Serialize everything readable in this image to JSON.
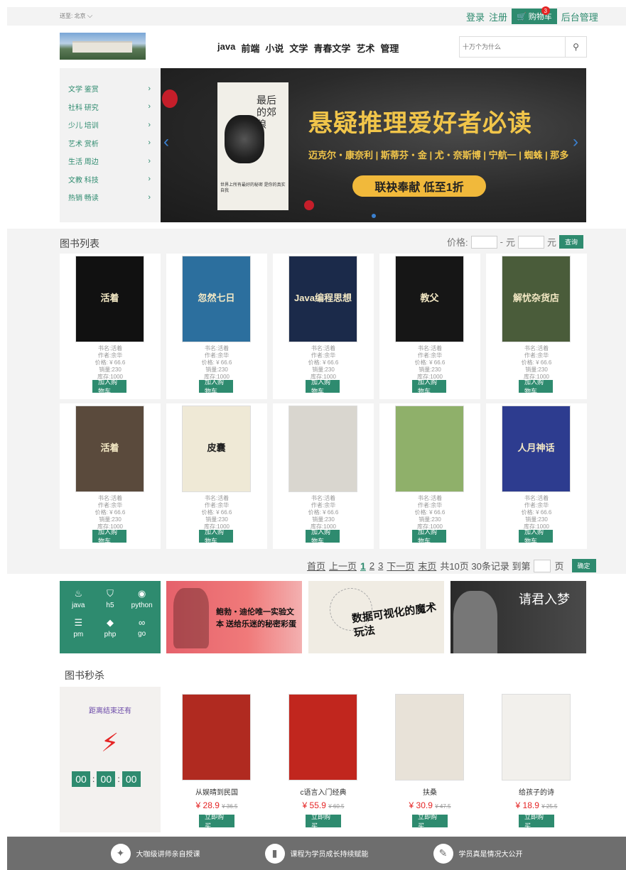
{
  "topbar": {
    "location": "送至: 北京",
    "login": "登录",
    "register": "注册",
    "cart_label": "购物车",
    "cart_count": "3",
    "admin": "后台管理"
  },
  "nav": {
    "items": [
      "java",
      "前端",
      "小说",
      "文学",
      "青春文学",
      "艺术",
      "管理"
    ]
  },
  "search": {
    "placeholder": "十万个为什么"
  },
  "categories": [
    "文学 鉴赏",
    "社科 研究",
    "少儿 培训",
    "艺术 赏析",
    "生活 周边",
    "文教 科技",
    "热销 畅读"
  ],
  "banner": {
    "headline": "悬疑推理爱好者必读",
    "authors": "迈克尔・康奈利 | 斯蒂芬・金 | 尤・奈斯博 | 宁航一 | 蜘蛛 | 那多",
    "promo": "联袂奉献  低至1折",
    "book_title": "最后的郊狼",
    "book_sub": "世界上所有最好的秘密 是你的真实自我"
  },
  "list": {
    "title": "图书列表",
    "price_label": "价格:",
    "unit": "元",
    "dash": "-",
    "query": "查询",
    "books": [
      {
        "name": "书名:活着",
        "author": "作者:余华",
        "price": "价格: ¥ 66.6",
        "sales": "销量:230",
        "stock": "库存:1000",
        "btn": "加入购物车",
        "cover_color": "#111111",
        "cover_text": "活着"
      },
      {
        "name": "书名:活着",
        "author": "作者:余华",
        "price": "价格: ¥ 66.6",
        "sales": "销量:230",
        "stock": "库存:1000",
        "btn": "加入购物车",
        "cover_color": "#2c6f9e",
        "cover_text": "忽然七日"
      },
      {
        "name": "书名:活着",
        "author": "作者:余华",
        "price": "价格: ¥ 66.6",
        "sales": "销量:230",
        "stock": "库存:1000",
        "btn": "加入购物车",
        "cover_color": "#1b2a4a",
        "cover_text": "Java编程思想"
      },
      {
        "name": "书名:活着",
        "author": "作者:余华",
        "price": "价格: ¥ 66.6",
        "sales": "销量:230",
        "stock": "库存:1000",
        "btn": "加入购物车",
        "cover_color": "#161616",
        "cover_text": "教父"
      },
      {
        "name": "书名:活着",
        "author": "作者:余华",
        "price": "价格: ¥ 66.6",
        "sales": "销量:230",
        "stock": "库存:1000",
        "btn": "加入购物车",
        "cover_color": "#4a5c3a",
        "cover_text": "解忧杂货店"
      },
      {
        "name": "书名:活着",
        "author": "作者:余华",
        "price": "价格: ¥ 66.6",
        "sales": "销量:230",
        "stock": "库存:1000",
        "btn": "加入购物车",
        "cover_color": "#5a4a3c",
        "cover_text": "活着"
      },
      {
        "name": "书名:活着",
        "author": "作者:余华",
        "price": "价格: ¥ 66.6",
        "sales": "销量:230",
        "stock": "库存:1000",
        "btn": "加入购物车",
        "cover_color": "#efe9d6",
        "cover_text": "皮囊"
      },
      {
        "name": "书名:活着",
        "author": "作者:余华",
        "price": "价格: ¥ 66.6",
        "sales": "销量:230",
        "stock": "库存:1000",
        "btn": "加入购物车",
        "cover_color": "#d9d6cf",
        "cover_text": ""
      },
      {
        "name": "书名:活着",
        "author": "作者:余华",
        "price": "价格: ¥ 66.6",
        "sales": "销量:230",
        "stock": "库存:1000",
        "btn": "加入购物车",
        "cover_color": "#8fb06a",
        "cover_text": ""
      },
      {
        "name": "书名:活着",
        "author": "作者:余华",
        "price": "价格: ¥ 66.6",
        "sales": "销量:230",
        "stock": "库存:1000",
        "btn": "加入购物车",
        "cover_color": "#2d3c8f",
        "cover_text": "人月神话"
      }
    ]
  },
  "pager": {
    "first": "首页",
    "prev": "上一页",
    "p1": "1",
    "p2": "2",
    "p3": "3",
    "next": "下一页",
    "last": "末页",
    "summary": "共10页 30条记录 到第",
    "page_unit": "页",
    "confirm": "确定"
  },
  "langs": [
    "java",
    "h5",
    "python",
    "pm",
    "php",
    "go"
  ],
  "promos": [
    "鲍勃・迪伦唯一实验文本 送给乐迷的秘密彩蛋",
    "数据可视化的魔术玩法",
    "请君入梦"
  ],
  "flash": {
    "title": "图书秒杀",
    "countdown_label": "距离结束还有",
    "hh": "00",
    "mm": "00",
    "ss": "00",
    "sep": ":",
    "items": [
      {
        "name": "从娱晴到民国",
        "price": "¥ 28.9",
        "old": "¥ 36.5",
        "btn": "立即购买",
        "cover_color": "#b02a20"
      },
      {
        "name": "c语言入门经典",
        "price": "¥ 55.9",
        "old": "¥ 60.5",
        "btn": "立即购买",
        "cover_color": "#c1261e"
      },
      {
        "name": "扶桑",
        "price": "¥ 30.9",
        "old": "¥ 47.5",
        "btn": "立即购买",
        "cover_color": "#e8e2d8"
      },
      {
        "name": "给孩子的诗",
        "price": "¥ 18.9",
        "old": "¥ 25.5",
        "btn": "立即购买",
        "cover_color": "#f2f0ec"
      }
    ]
  },
  "footer": [
    "大咖级讲师亲自授课",
    "课程为学员成长持续赋能",
    "学员真是情况大公开"
  ],
  "colors": {
    "accent": "#2e8b6f",
    "price": "#e52525"
  }
}
